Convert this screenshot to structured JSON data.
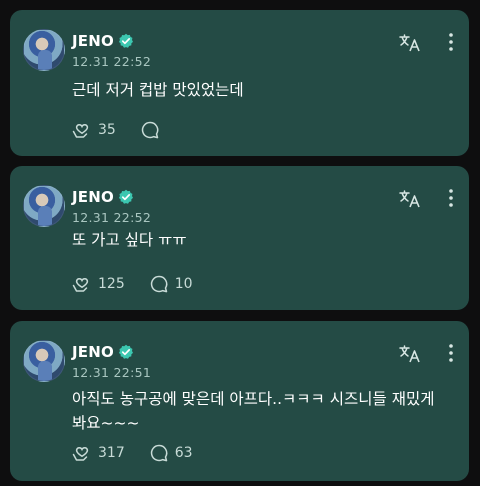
{
  "posts": [
    {
      "author": "JENO",
      "time": "12.31 22:52",
      "text": "근데 저거 컵밥 맛있었는데",
      "likes": "35",
      "comments": ""
    },
    {
      "author": "JENO",
      "time": "12.31 22:52",
      "text": "또 가고 싶다 ㅠㅠ",
      "likes": "125",
      "comments": "10"
    },
    {
      "author": "JENO",
      "time": "12.31 22:51",
      "text": "아직도 농구공에 맞은데 아프다..ㅋㅋㅋ 시즈니들 재밌게 봐요~~~",
      "likes": "317",
      "comments": "63"
    }
  ],
  "icons": {
    "verified": "verified-badge-icon",
    "translate": "translate-icon",
    "more": "more-vertical-icon",
    "like": "heart-hand-icon",
    "comment": "comment-bubble-icon"
  },
  "colors": {
    "card": "#244b45",
    "verified": "#3cc7b0",
    "background": "#0e0e0f"
  }
}
